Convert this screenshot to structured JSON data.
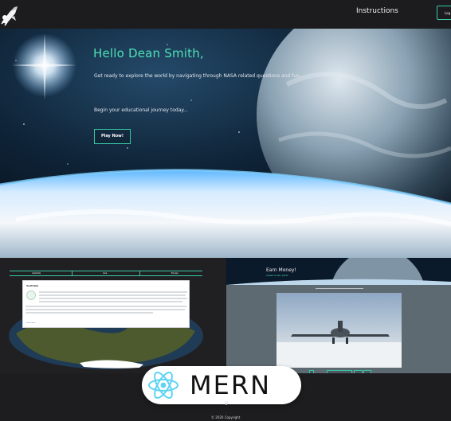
{
  "navbar": {
    "logo_icon": "rocket-icon",
    "instructions_label": "Instructions",
    "logout_label": "Log"
  },
  "hero": {
    "title": "Hello Dean Smith,",
    "subtitle": "Get ready to explore the world by navigating through NASA related questions and fun.",
    "journey_text": "Begin your educational journey today...",
    "play_button": "Play Now!"
  },
  "game_preview": {
    "tabs": [
      "Australia",
      "Asia",
      "Europe"
    ],
    "card_title": "Australia",
    "card_link": "Learn more"
  },
  "earn_preview": {
    "title": "Earn Money!",
    "subtitle": "Answer to earn points"
  },
  "badge": {
    "react_icon": "react-logo-icon",
    "text": "MERN"
  },
  "footer": {
    "copyright": "© 2020 Copyright"
  },
  "colors": {
    "accent": "#39c7a4",
    "hero_title": "#4fe1b6",
    "background": "#1e1e20"
  }
}
